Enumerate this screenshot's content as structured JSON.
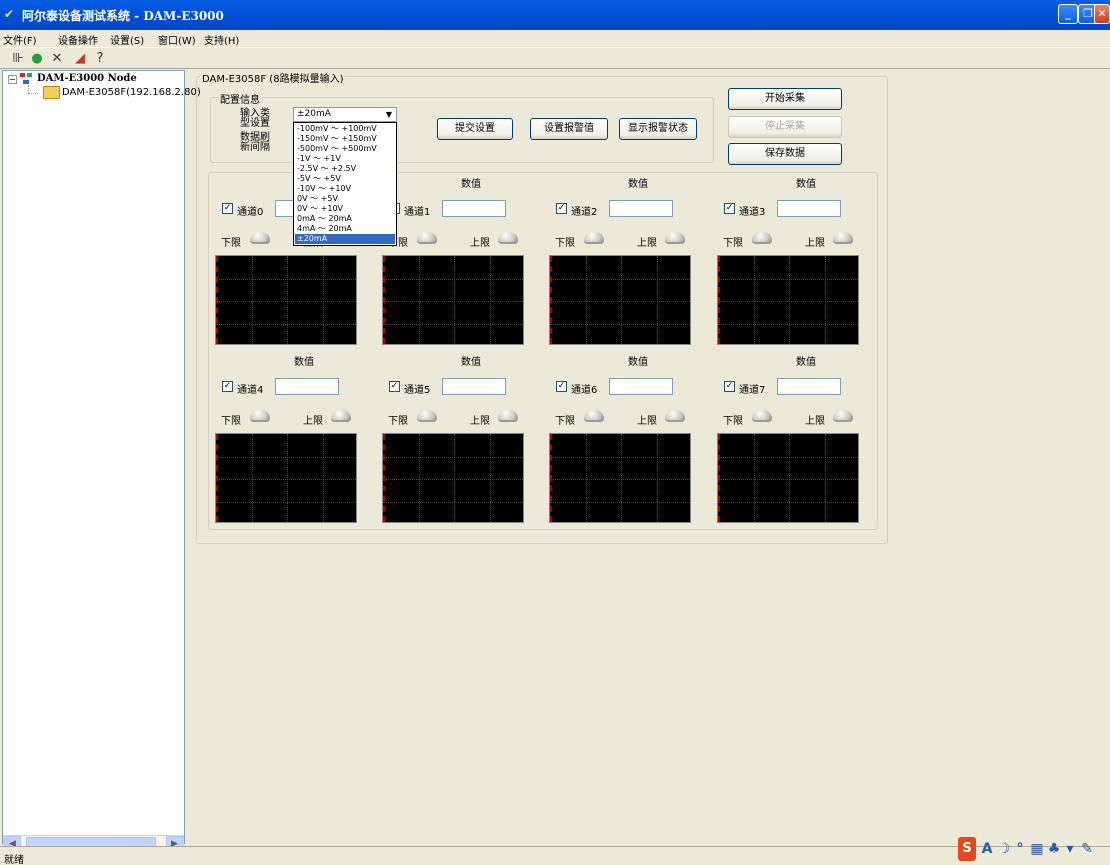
{
  "window": {
    "title": "阿尔泰设备测试系统 - DAM-E3000",
    "icon": "app-logo-icon",
    "controls": [
      "minimize",
      "maximize",
      "close"
    ]
  },
  "menu": {
    "file": "文件(F)",
    "device_ops": "设备操作",
    "settings": "设置(S)",
    "window": "窗口(W)",
    "support": "支持(H)"
  },
  "toolbar": {
    "icons": [
      "connect-icon",
      "search-device-icon",
      "delete-icon",
      "chart-icon",
      "help-icon"
    ]
  },
  "tree": {
    "root": "DAM-E3000 Node",
    "child": "DAM-E3058F(192.168.2.80)"
  },
  "main": {
    "group_title": "DAM-E3058F (8路模拟量输入)",
    "config_title": "配置信息",
    "input_type_label_1": "输入类",
    "input_type_label_2": "型设置",
    "refresh_label_1": "数据刷",
    "refresh_label_2": "新间隔",
    "input_type_value": "±20mA",
    "input_type_options": [
      "-100mV ～ +100mV",
      "-150mV ～ +150mV",
      "-500mV ～ +500mV",
      "-1V ～ +1V",
      "-2.5V ～ +2.5V",
      "-5V ～ +5V",
      "-10V ～ +10V",
      "0V ～ +5V",
      "0V ～ +10V",
      "0mA ～ 20mA",
      "4mA ～ 20mA",
      "±20mA"
    ],
    "submit_label": "提交设置",
    "set_alarm_label": "设置报警值",
    "show_alarm_label": "显示报警状态",
    "start_label": "开始采集",
    "stop_label": "停止采集",
    "save_label": "保存数据"
  },
  "channels": {
    "value_label": "数值",
    "low_label": "下限",
    "high_label": "上限",
    "names": [
      "通道0",
      "通道1",
      "通道2",
      "通道3",
      "通道4",
      "通道5",
      "通道6",
      "通道7"
    ],
    "checked": [
      true,
      true,
      true,
      true,
      true,
      true,
      true,
      true
    ],
    "values": [
      "",
      "",
      "",
      "",
      "",
      "",
      "",
      ""
    ]
  },
  "status": {
    "text": "就绪"
  },
  "colors": {
    "titlebar": "#0054e3",
    "selection": "#316ac5",
    "scope_bg": "#000000",
    "scope_axis": "#b40000"
  }
}
